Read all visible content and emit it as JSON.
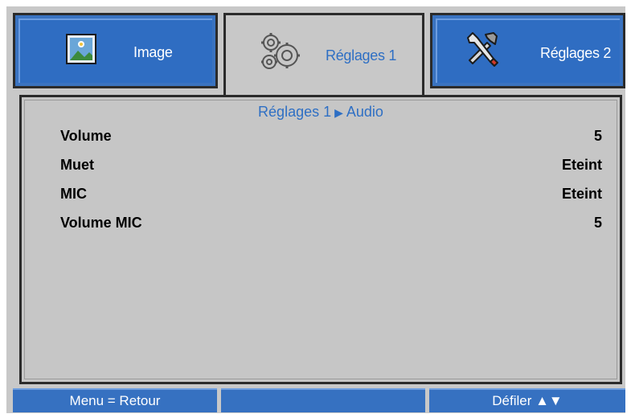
{
  "tabs": [
    {
      "label": "Image",
      "icon": "image-icon",
      "active": false
    },
    {
      "label": "Réglages 1",
      "icon": "gears-icon",
      "active": true
    },
    {
      "label": "Réglages 2",
      "icon": "tools-icon",
      "active": false
    }
  ],
  "breadcrumb": {
    "parent": "Réglages 1",
    "arrow": "▶",
    "current": "Audio"
  },
  "rows": [
    {
      "name": "Volume",
      "value": "5"
    },
    {
      "name": "Muet",
      "value": "Eteint"
    },
    {
      "name": "MIC",
      "value": "Eteint"
    },
    {
      "name": "Volume MIC",
      "value": "5"
    }
  ],
  "footer": {
    "left": "Menu = Retour",
    "middle": "",
    "right": "Défiler ▲▼"
  },
  "colors": {
    "tab_blue": "#2f6dc2",
    "accent_text": "#2e6fc4",
    "panel_gray": "#c6c6c6"
  }
}
